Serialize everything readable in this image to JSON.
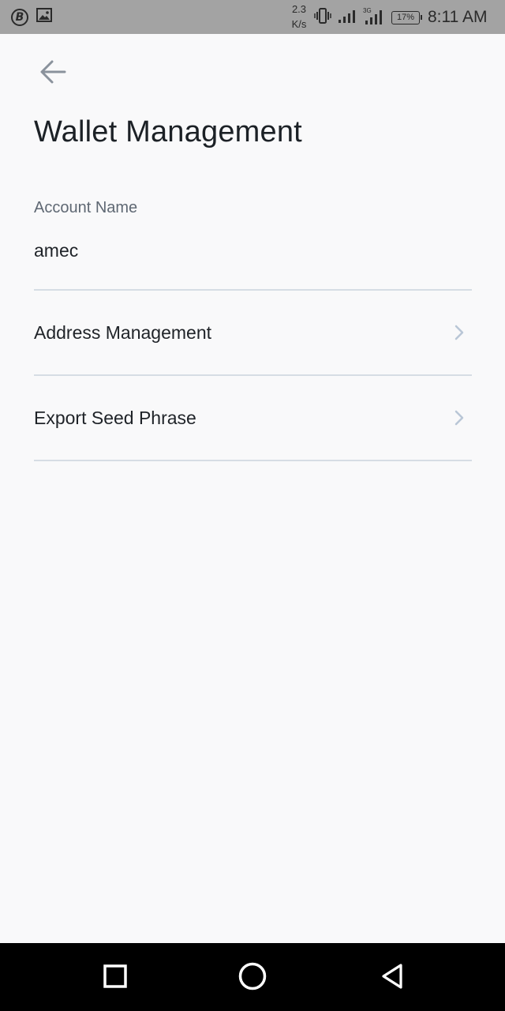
{
  "status_bar": {
    "net_speed_value": "2.3",
    "net_speed_unit": "K/s",
    "battery": "17%",
    "time": "8:11 AM",
    "icons": [
      "bitcoin-icon",
      "image-icon",
      "vibrate-icon",
      "signal-icon",
      "signal-3g-icon",
      "battery-icon"
    ]
  },
  "header": {
    "back_icon": "arrow-left-icon",
    "title": "Wallet Management"
  },
  "account": {
    "label": "Account Name",
    "value": "amec"
  },
  "menu": [
    {
      "label": "Address Management",
      "icon": "chevron-right-icon"
    },
    {
      "label": "Export Seed Phrase",
      "icon": "chevron-right-icon"
    }
  ],
  "nav_bar": {
    "icons": [
      "recents-square-icon",
      "home-circle-icon",
      "back-triangle-icon"
    ]
  },
  "colors": {
    "background": "#f9f9fa",
    "status_bar": "#a3a3a3",
    "divider": "#d6dde4",
    "chevron": "#b9c6d6",
    "nav_bar": "#000000"
  }
}
